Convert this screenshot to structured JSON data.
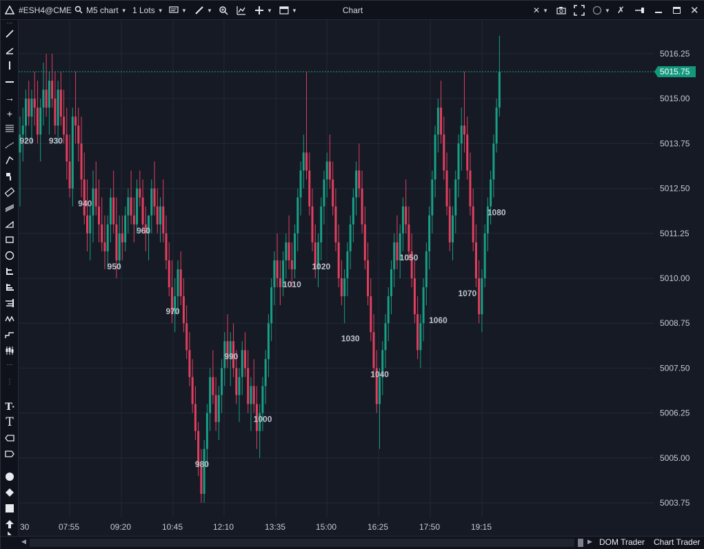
{
  "toolbar": {
    "logo": "app-logo-icon",
    "symbol": "#ESH4@CME",
    "chart_type": "M5 chart",
    "lots": "1 Lots",
    "title": "Chart"
  },
  "colors": {
    "background": "#161a25",
    "bull": "#17a085",
    "bear": "#e23f5f",
    "grid": "#232838",
    "axis_text": "#c7cbd3",
    "price_line": "#1ea58a",
    "price_label_bg": "#13987d"
  },
  "price_axis": {
    "ticks": [
      "5016.25",
      "5015.00",
      "5013.75",
      "5012.50",
      "5011.25",
      "5010.00",
      "5008.75",
      "5007.50",
      "5006.25",
      "5005.00",
      "5003.75"
    ],
    "current_price": "5015.75"
  },
  "time_axis": {
    "ticks": [
      "30",
      "07:55",
      "09:20",
      "10:45",
      "12:10",
      "13:35",
      "15:00",
      "16:25",
      "17:50",
      "19:15"
    ]
  },
  "bar_numbers": [
    "920",
    "930",
    "940",
    "950",
    "960",
    "970",
    "980",
    "990",
    "1000",
    "1010",
    "1020",
    "1030",
    "1040",
    "1050",
    "1060",
    "1070",
    "1080"
  ],
  "tabs": [
    "DOM Trader",
    "Chart Trader"
  ],
  "chart_data": {
    "type": "candlestick",
    "symbol": "#ESH4@CME",
    "timeframe": "M5",
    "y_range": [
      5003.25,
      5017.5
    ],
    "current_price": 5015.75,
    "bar_labels": [
      {
        "label": "920",
        "bar": 2,
        "value": 5013.75
      },
      {
        "label": "930",
        "bar": 12,
        "value": 5013.75
      },
      {
        "label": "940",
        "bar": 22,
        "value": 5012.0
      },
      {
        "label": "950",
        "bar": 32,
        "value": 5010.25
      },
      {
        "label": "960",
        "bar": 42,
        "value": 5011.25
      },
      {
        "label": "970",
        "bar": 52,
        "value": 5009.0
      },
      {
        "label": "980",
        "bar": 62,
        "value": 5004.75
      },
      {
        "label": "990",
        "bar": 72,
        "value": 5007.75
      },
      {
        "label": "1000",
        "bar": 82,
        "value": 5006.0
      },
      {
        "label": "1010",
        "bar": 92,
        "value": 5009.75
      },
      {
        "label": "1020",
        "bar": 102,
        "value": 5010.25
      },
      {
        "label": "1030",
        "bar": 112,
        "value": 5008.25
      },
      {
        "label": "1040",
        "bar": 122,
        "value": 5007.25
      },
      {
        "label": "1050",
        "bar": 132,
        "value": 5010.5
      },
      {
        "label": "1060",
        "bar": 142,
        "value": 5008.75
      },
      {
        "label": "1070",
        "bar": 152,
        "value": 5009.5
      },
      {
        "label": "1080",
        "bar": 162,
        "value": 5011.75
      }
    ],
    "candles": [
      [
        5013.5,
        5014.5,
        5012.0,
        5014.0
      ],
      [
        5014.0,
        5014.75,
        5013.25,
        5014.25
      ],
      [
        5014.25,
        5015.25,
        5013.75,
        5015.0
      ],
      [
        5015.0,
        5015.5,
        5014.25,
        5014.5
      ],
      [
        5014.5,
        5015.25,
        5013.75,
        5015.0
      ],
      [
        5015.0,
        5015.75,
        5014.25,
        5014.75
      ],
      [
        5014.75,
        5015.5,
        5013.75,
        5014.0
      ],
      [
        5014.0,
        5015.0,
        5013.25,
        5014.75
      ],
      [
        5014.75,
        5016.0,
        5014.25,
        5015.25
      ],
      [
        5015.25,
        5016.25,
        5014.5,
        5014.75
      ],
      [
        5014.75,
        5015.75,
        5014.0,
        5015.5
      ],
      [
        5015.5,
        5016.25,
        5014.75,
        5015.0
      ],
      [
        5015.0,
        5015.75,
        5014.0,
        5014.25
      ],
      [
        5014.25,
        5015.5,
        5013.75,
        5015.25
      ],
      [
        5015.25,
        5015.75,
        5014.25,
        5014.5
      ],
      [
        5014.5,
        5015.25,
        5013.75,
        5014.0
      ],
      [
        5014.0,
        5014.75,
        5012.75,
        5013.25
      ],
      [
        5013.25,
        5014.0,
        5012.25,
        5012.5
      ],
      [
        5012.5,
        5014.75,
        5012.0,
        5014.5
      ],
      [
        5014.5,
        5015.75,
        5013.75,
        5014.25
      ],
      [
        5014.25,
        5014.75,
        5013.25,
        5013.75
      ],
      [
        5013.75,
        5014.5,
        5012.25,
        5012.75
      ],
      [
        5012.75,
        5013.5,
        5011.5,
        5011.75
      ],
      [
        5011.75,
        5012.75,
        5010.75,
        5011.25
      ],
      [
        5011.25,
        5012.0,
        5010.5,
        5011.75
      ],
      [
        5011.75,
        5013.0,
        5011.0,
        5012.5
      ],
      [
        5012.5,
        5013.25,
        5011.75,
        5012.0
      ],
      [
        5012.0,
        5012.75,
        5011.0,
        5011.5
      ],
      [
        5011.5,
        5012.25,
        5010.75,
        5011.0
      ],
      [
        5011.0,
        5011.75,
        5010.25,
        5010.75
      ],
      [
        5010.75,
        5011.75,
        5010.25,
        5011.5
      ],
      [
        5011.5,
        5012.5,
        5011.0,
        5012.25
      ],
      [
        5012.25,
        5013.0,
        5011.25,
        5011.5
      ],
      [
        5011.5,
        5012.25,
        5010.0,
        5010.5
      ],
      [
        5010.5,
        5011.75,
        5010.25,
        5011.25
      ],
      [
        5011.25,
        5011.75,
        5010.5,
        5011.0
      ],
      [
        5011.0,
        5012.0,
        5010.75,
        5011.75
      ],
      [
        5011.75,
        5012.5,
        5011.25,
        5012.25
      ],
      [
        5012.25,
        5013.0,
        5011.5,
        5011.75
      ],
      [
        5011.75,
        5012.25,
        5011.0,
        5011.5
      ],
      [
        5011.5,
        5012.75,
        5011.25,
        5012.5
      ],
      [
        5012.5,
        5013.0,
        5012.0,
        5012.25
      ],
      [
        5012.25,
        5012.75,
        5011.25,
        5011.5
      ],
      [
        5011.5,
        5012.0,
        5010.75,
        5011.25
      ],
      [
        5011.25,
        5011.75,
        5010.5,
        5011.75
      ],
      [
        5011.75,
        5012.75,
        5011.25,
        5012.5
      ],
      [
        5012.5,
        5013.25,
        5011.75,
        5012.0
      ],
      [
        5012.0,
        5012.5,
        5011.25,
        5011.5
      ],
      [
        5011.5,
        5012.25,
        5011.0,
        5012.0
      ],
      [
        5012.0,
        5012.75,
        5011.0,
        5011.25
      ],
      [
        5011.25,
        5011.75,
        5010.25,
        5010.5
      ],
      [
        5010.5,
        5011.0,
        5009.5,
        5009.75
      ],
      [
        5009.75,
        5010.5,
        5008.75,
        5009.0
      ],
      [
        5009.0,
        5010.0,
        5008.5,
        5009.5
      ],
      [
        5009.5,
        5010.5,
        5009.0,
        5010.25
      ],
      [
        5010.25,
        5010.75,
        5009.25,
        5009.5
      ],
      [
        5009.5,
        5010.0,
        5008.5,
        5008.75
      ],
      [
        5008.75,
        5009.25,
        5007.75,
        5008.0
      ],
      [
        5008.0,
        5008.5,
        5007.0,
        5007.25
      ],
      [
        5007.25,
        5007.75,
        5006.25,
        5006.5
      ],
      [
        5006.5,
        5007.0,
        5005.5,
        5005.75
      ],
      [
        5005.75,
        5006.0,
        5004.5,
        5004.75
      ],
      [
        5004.75,
        5005.25,
        5003.75,
        5004.0
      ],
      [
        5004.0,
        5005.5,
        5003.75,
        5005.25
      ],
      [
        5005.25,
        5006.5,
        5004.75,
        5006.25
      ],
      [
        5006.25,
        5007.5,
        5005.75,
        5007.25
      ],
      [
        5007.25,
        5008.0,
        5006.5,
        5006.75
      ],
      [
        5006.75,
        5007.25,
        5005.75,
        5006.0
      ],
      [
        5006.0,
        5007.0,
        5005.5,
        5006.75
      ],
      [
        5006.75,
        5007.75,
        5006.25,
        5007.5
      ],
      [
        5007.5,
        5008.5,
        5007.0,
        5008.25
      ],
      [
        5008.25,
        5009.0,
        5007.5,
        5007.75
      ],
      [
        5007.75,
        5008.5,
        5007.0,
        5008.25
      ],
      [
        5008.25,
        5008.75,
        5007.25,
        5007.5
      ],
      [
        5007.5,
        5008.0,
        5006.5,
        5006.75
      ],
      [
        5006.75,
        5007.5,
        5006.0,
        5007.25
      ],
      [
        5007.25,
        5008.25,
        5006.75,
        5008.0
      ],
      [
        5008.0,
        5008.5,
        5007.25,
        5007.5
      ],
      [
        5007.5,
        5008.0,
        5006.25,
        5006.5
      ],
      [
        5006.5,
        5007.25,
        5005.75,
        5007.0
      ],
      [
        5007.0,
        5007.75,
        5006.25,
        5006.5
      ],
      [
        5006.5,
        5007.0,
        5005.25,
        5005.75
      ],
      [
        5005.75,
        5006.5,
        5005.0,
        5006.25
      ],
      [
        5006.25,
        5007.25,
        5005.75,
        5007.0
      ],
      [
        5007.0,
        5008.0,
        5006.5,
        5007.75
      ],
      [
        5007.75,
        5009.0,
        5007.25,
        5008.75
      ],
      [
        5008.75,
        5010.0,
        5008.25,
        5009.75
      ],
      [
        5009.75,
        5010.75,
        5009.25,
        5010.5
      ],
      [
        5010.5,
        5011.25,
        5009.75,
        5010.0
      ],
      [
        5010.0,
        5010.5,
        5009.25,
        5009.75
      ],
      [
        5009.75,
        5010.75,
        5009.5,
        5010.5
      ],
      [
        5010.5,
        5011.25,
        5010.0,
        5011.0
      ],
      [
        5011.0,
        5011.75,
        5010.25,
        5010.5
      ],
      [
        5010.5,
        5011.0,
        5009.75,
        5010.25
      ],
      [
        5010.25,
        5011.5,
        5010.0,
        5011.25
      ],
      [
        5011.25,
        5012.5,
        5010.75,
        5012.25
      ],
      [
        5012.25,
        5013.25,
        5011.75,
        5013.0
      ],
      [
        5013.0,
        5014.0,
        5012.5,
        5013.5
      ],
      [
        5013.5,
        5015.75,
        5012.75,
        5013.0
      ],
      [
        5013.0,
        5013.5,
        5011.75,
        5012.0
      ],
      [
        5012.0,
        5012.5,
        5010.75,
        5011.0
      ],
      [
        5011.0,
        5011.5,
        5010.0,
        5010.25
      ],
      [
        5010.25,
        5011.25,
        5009.75,
        5011.0
      ],
      [
        5011.0,
        5012.25,
        5010.5,
        5012.0
      ],
      [
        5012.0,
        5013.0,
        5011.5,
        5012.75
      ],
      [
        5012.75,
        5013.5,
        5012.25,
        5013.25
      ],
      [
        5013.25,
        5014.0,
        5012.5,
        5012.75
      ],
      [
        5012.75,
        5013.25,
        5011.75,
        5012.0
      ],
      [
        5012.0,
        5012.5,
        5010.75,
        5011.0
      ],
      [
        5011.0,
        5011.5,
        5009.75,
        5010.0
      ],
      [
        5010.0,
        5010.5,
        5009.25,
        5009.5
      ],
      [
        5009.5,
        5010.25,
        5008.75,
        5010.0
      ],
      [
        5010.0,
        5011.0,
        5009.5,
        5010.75
      ],
      [
        5010.75,
        5011.75,
        5010.25,
        5011.5
      ],
      [
        5011.5,
        5012.5,
        5011.0,
        5012.25
      ],
      [
        5012.25,
        5013.25,
        5011.75,
        5013.0
      ],
      [
        5013.0,
        5013.75,
        5012.25,
        5012.5
      ],
      [
        5012.5,
        5013.0,
        5011.25,
        5011.5
      ],
      [
        5011.5,
        5012.0,
        5010.25,
        5010.5
      ],
      [
        5010.5,
        5011.0,
        5009.25,
        5009.5
      ],
      [
        5009.5,
        5010.0,
        5008.25,
        5008.5
      ],
      [
        5008.5,
        5009.0,
        5007.25,
        5007.5
      ],
      [
        5007.5,
        5008.0,
        5006.25,
        5006.5
      ],
      [
        5006.5,
        5007.5,
        5005.25,
        5007.25
      ],
      [
        5007.25,
        5008.25,
        5006.75,
        5008.0
      ],
      [
        5008.0,
        5009.0,
        5007.5,
        5008.75
      ],
      [
        5008.75,
        5009.75,
        5008.25,
        5009.5
      ],
      [
        5009.5,
        5010.5,
        5009.0,
        5010.25
      ],
      [
        5010.25,
        5011.25,
        5009.75,
        5011.0
      ],
      [
        5011.0,
        5011.75,
        5010.25,
        5010.5
      ],
      [
        5010.5,
        5011.5,
        5010.0,
        5011.25
      ],
      [
        5011.25,
        5012.25,
        5010.75,
        5012.0
      ],
      [
        5012.0,
        5012.75,
        5011.25,
        5011.5
      ],
      [
        5011.5,
        5012.0,
        5010.5,
        5010.75
      ],
      [
        5010.75,
        5011.25,
        5009.75,
        5010.0
      ],
      [
        5010.0,
        5010.5,
        5008.75,
        5009.0
      ],
      [
        5009.0,
        5009.5,
        5007.75,
        5008.0
      ],
      [
        5008.0,
        5009.0,
        5007.5,
        5008.75
      ],
      [
        5008.75,
        5010.0,
        5008.25,
        5009.75
      ],
      [
        5009.75,
        5011.0,
        5009.25,
        5010.75
      ],
      [
        5010.75,
        5012.0,
        5010.25,
        5011.75
      ],
      [
        5011.75,
        5013.0,
        5011.25,
        5012.75
      ],
      [
        5012.75,
        5014.25,
        5012.25,
        5014.0
      ],
      [
        5014.0,
        5015.0,
        5013.5,
        5014.75
      ],
      [
        5014.75,
        5015.5,
        5013.75,
        5014.0
      ],
      [
        5014.0,
        5014.5,
        5012.75,
        5013.0
      ],
      [
        5013.0,
        5013.5,
        5011.75,
        5012.0
      ],
      [
        5012.0,
        5012.5,
        5010.75,
        5011.0
      ],
      [
        5011.0,
        5012.0,
        5010.5,
        5011.75
      ],
      [
        5011.75,
        5013.0,
        5011.25,
        5012.75
      ],
      [
        5012.75,
        5014.0,
        5012.25,
        5013.75
      ],
      [
        5013.75,
        5014.75,
        5013.0,
        5014.25
      ],
      [
        5014.25,
        5015.75,
        5013.5,
        5014.0
      ],
      [
        5014.0,
        5014.5,
        5012.75,
        5013.0
      ],
      [
        5013.0,
        5013.5,
        5011.75,
        5012.0
      ],
      [
        5012.0,
        5012.5,
        5010.75,
        5011.0
      ],
      [
        5011.0,
        5011.5,
        5009.75,
        5010.0
      ],
      [
        5010.0,
        5010.5,
        5008.75,
        5009.0
      ],
      [
        5009.0,
        5010.25,
        5008.5,
        5010.0
      ],
      [
        5010.0,
        5011.5,
        5009.75,
        5011.25
      ],
      [
        5011.25,
        5012.25,
        5010.75,
        5012.0
      ],
      [
        5012.0,
        5013.0,
        5011.5,
        5012.75
      ],
      [
        5012.75,
        5014.0,
        5012.25,
        5013.75
      ],
      [
        5013.75,
        5015.0,
        5013.5,
        5014.75
      ],
      [
        5014.75,
        5016.75,
        5014.5,
        5015.75
      ]
    ]
  }
}
